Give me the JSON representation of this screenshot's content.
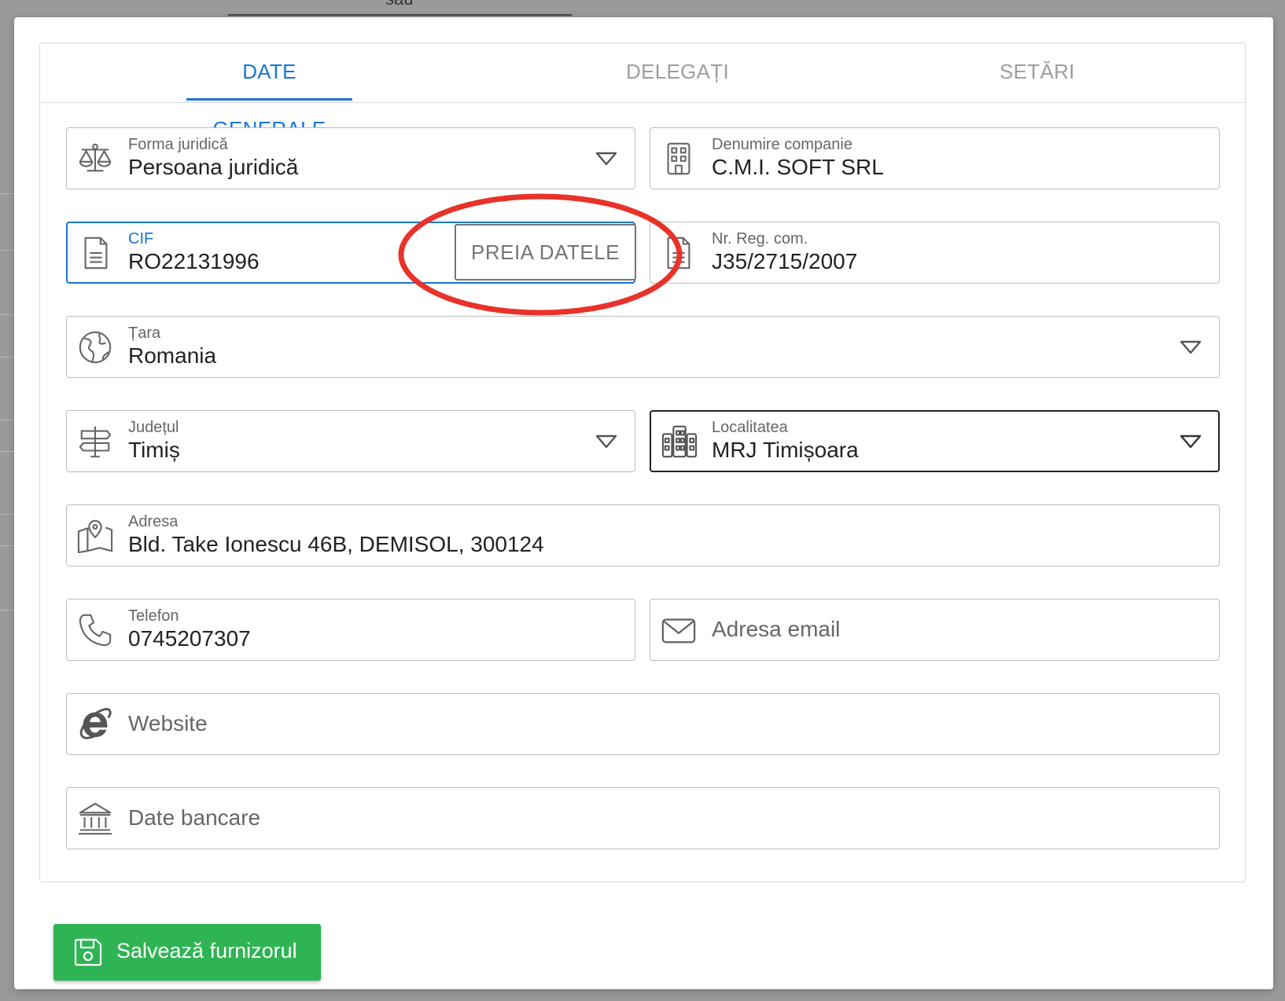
{
  "background": {
    "top_label": "sau"
  },
  "tabs": [
    {
      "label": "DATE GENERALE",
      "active": true
    },
    {
      "label": "DELEGAȚI",
      "active": false
    },
    {
      "label": "SETĂRI",
      "active": false
    }
  ],
  "fields": {
    "forma_juridica": {
      "label": "Forma juridică",
      "value": "Persoana juridică",
      "icon": "balance-scale-icon"
    },
    "denumire": {
      "label": "Denumire companie",
      "value": "C.M.I. SOFT SRL",
      "icon": "building-icon"
    },
    "cif": {
      "label": "CIF",
      "value": "RO22131996",
      "icon": "document-icon",
      "button": "PREIA DATELE"
    },
    "reg_com": {
      "label": "Nr. Reg. com.",
      "value": "J35/2715/2007",
      "icon": "document-icon"
    },
    "tara": {
      "label": "Țara",
      "value": "Romania",
      "icon": "globe-icon"
    },
    "judet": {
      "label": "Județul",
      "value": "Timiș",
      "icon": "signpost-icon"
    },
    "localitate": {
      "label": "Localitatea",
      "value": "MRJ Timișoara",
      "icon": "city-icon"
    },
    "adresa": {
      "label": "Adresa",
      "value": "Bld. Take Ionescu 46B, DEMISOL, 300124",
      "icon": "map-pin-icon"
    },
    "telefon": {
      "label": "Telefon",
      "value": "0745207307",
      "icon": "phone-icon"
    },
    "email": {
      "placeholder": "Adresa email",
      "icon": "envelope-icon"
    },
    "website": {
      "placeholder": "Website",
      "icon": "internet-explorer-icon"
    },
    "banca": {
      "placeholder": "Date bancare",
      "icon": "bank-icon"
    }
  },
  "save_button": {
    "label": "Salvează furnizorul",
    "icon": "floppy-disk-icon"
  },
  "colors": {
    "accent": "#1976d2",
    "save": "#2fb454",
    "annotation": "#e8322a"
  }
}
